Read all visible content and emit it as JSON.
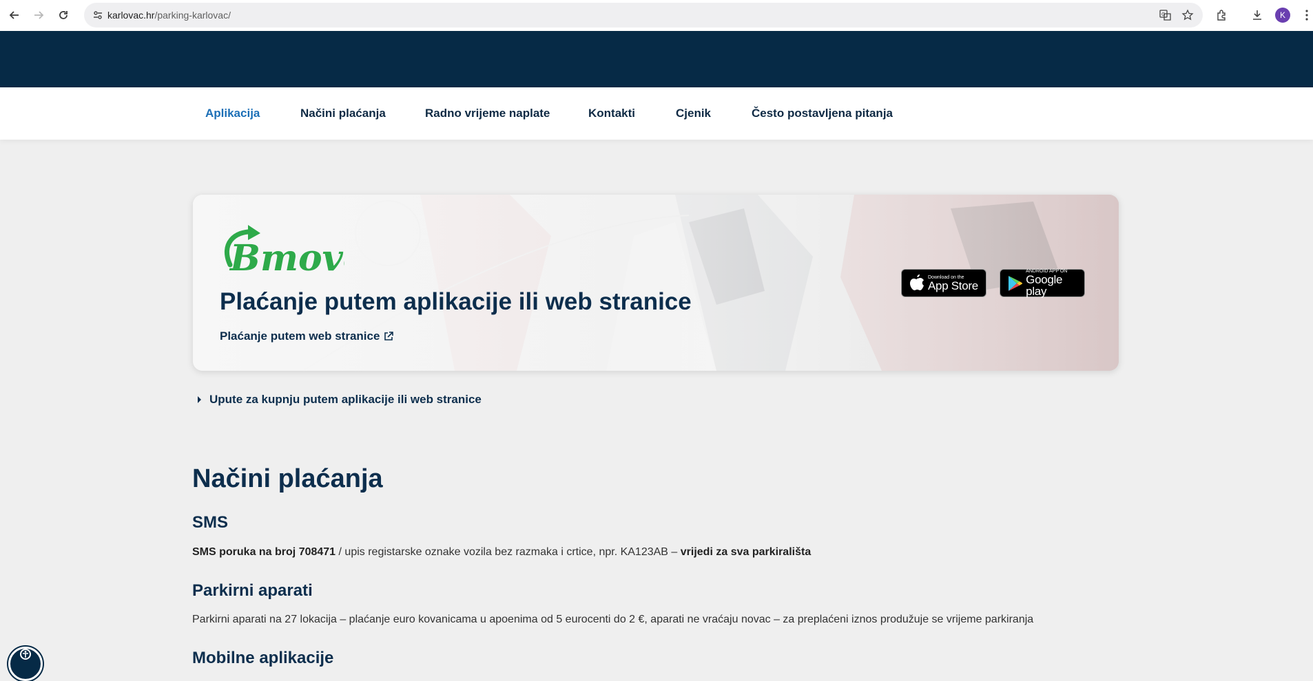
{
  "browser": {
    "url_host": "karlovac.hr",
    "url_path": "/parking-karlovac/",
    "profile_initial": "K"
  },
  "nav": {
    "items": [
      {
        "label": "Aplikacija",
        "active": true
      },
      {
        "label": "Načini plaćanja",
        "active": false
      },
      {
        "label": "Radno vrijeme naplate",
        "active": false
      },
      {
        "label": "Kontakti",
        "active": false
      },
      {
        "label": "Cjenik",
        "active": false
      },
      {
        "label": "Često postavljena pitanja",
        "active": false
      }
    ]
  },
  "hero": {
    "logo_text": "Bmove",
    "title": "Plaćanje putem aplikacije ili web stranice",
    "web_link": "Plaćanje putem web stranice",
    "app_store": {
      "small": "Download on the",
      "big": "App Store"
    },
    "google_play": {
      "small": "ANDROID APP ON",
      "big": "Google play"
    }
  },
  "accordion": {
    "label": "Upute za kupnju putem aplikacije ili web stranice"
  },
  "content": {
    "heading": "Načini plaćanja",
    "sms": {
      "title": "SMS",
      "bold_lead": "SMS poruka na broj 708471",
      "text": " / upis registarske oznake vozila bez razmaka i crtice, npr. KA123AB – ",
      "bold_tail": "vrijedi za sva parkirališta"
    },
    "parkirni": {
      "title": "Parkirni aparati",
      "text": "Parkirni aparati na 27 lokacija – plaćanje euro kovanicama u apoenima od 5 eurocenti do 2 €, aparati ne vraćaju novac – za preplaćeni iznos produžuje se vrijeme parkiranja"
    },
    "mobilne": {
      "title": "Mobilne aplikacije"
    }
  },
  "colors": {
    "navy": "#062a46",
    "heading": "#0d2e4d",
    "active_nav": "#1c6fb6",
    "bmove_green": "#2eaa4a"
  }
}
